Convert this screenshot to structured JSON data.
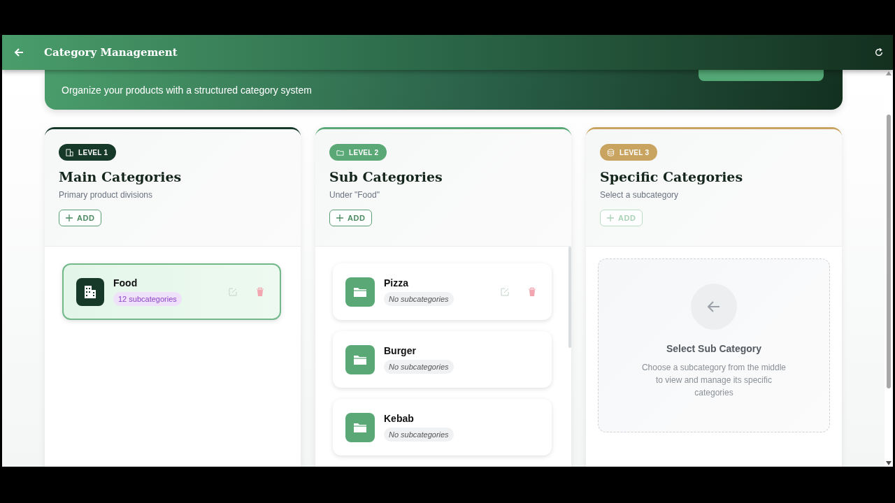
{
  "app_bar": {
    "title": "Category Management"
  },
  "banner": {
    "subtitle": "Organize your products with a structured category system"
  },
  "columns": [
    {
      "kind": "main",
      "level_label": "LEVEL 1",
      "color": "#17392a",
      "title": "Main Categories",
      "subtitle": "Primary product divisions",
      "add_label": "ADD",
      "add_disabled": false,
      "items": [
        {
          "name": "Food",
          "count": "12 subcategories",
          "selected": true,
          "actions_visible": true
        }
      ]
    },
    {
      "kind": "sub",
      "level_label": "LEVEL 2",
      "color": "#5aa876",
      "title": "Sub Categories",
      "subtitle": "Under \"Food\"",
      "add_label": "ADD",
      "add_disabled": false,
      "items": [
        {
          "name": "Pizza",
          "count": "No subcategories",
          "selected": false,
          "actions_visible": true
        },
        {
          "name": "Burger",
          "count": "No subcategories",
          "selected": false,
          "actions_visible": false
        },
        {
          "name": "Kebab",
          "count": "No subcategories",
          "selected": false,
          "actions_visible": false
        }
      ]
    },
    {
      "kind": "specific",
      "level_label": "LEVEL 3",
      "color": "#c9a461",
      "title": "Specific Categories",
      "subtitle": "Select a subcategory",
      "add_label": "ADD",
      "add_disabled": true,
      "empty_state": {
        "title": "Select Sub Category",
        "text": "Choose a subcategory from the middle to view and manage its specific categories"
      }
    }
  ]
}
